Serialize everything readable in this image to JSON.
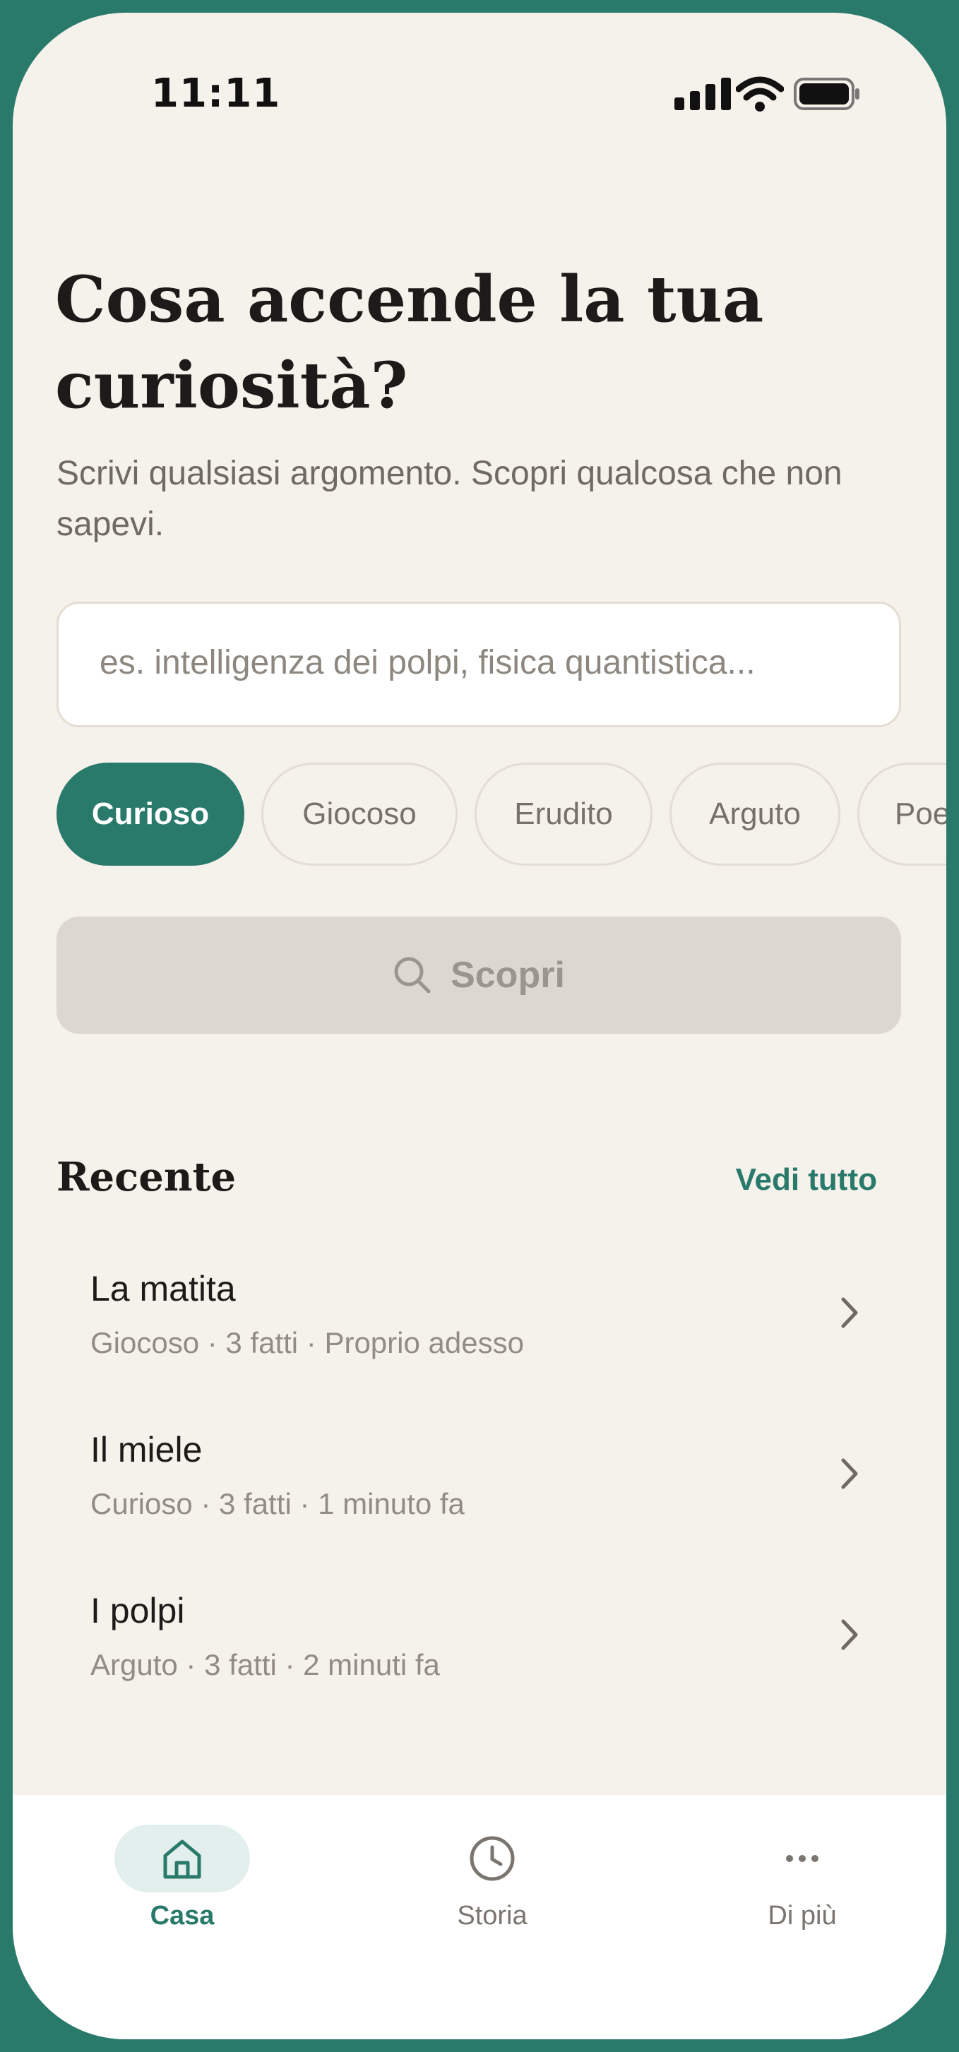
{
  "status_bar": {
    "time": "11:11"
  },
  "header": {
    "title": "Cosa accende la tua curiosità?",
    "subtitle": "Scrivi qualsiasi argomento. Scopri qualcosa che non sapevi."
  },
  "search": {
    "placeholder": "es. intelligenza dei polpi, fisica quantistica..."
  },
  "tones": [
    {
      "label": "Curioso",
      "selected": true
    },
    {
      "label": "Giocoso",
      "selected": false
    },
    {
      "label": "Erudito",
      "selected": false
    },
    {
      "label": "Arguto",
      "selected": false
    },
    {
      "label": "Poe",
      "selected": false
    }
  ],
  "discover_button": {
    "label": "Scopri",
    "enabled": false
  },
  "recent": {
    "title": "Recente",
    "see_all": "Vedi tutto",
    "items": [
      {
        "title": "La matita",
        "meta": "Giocoso · 3 fatti · Proprio adesso"
      },
      {
        "title": "Il miele",
        "meta": "Curioso · 3 fatti · 1 minuto fa"
      },
      {
        "title": "I polpi",
        "meta": "Arguto · 3 fatti · 2 minuti fa"
      }
    ]
  },
  "tab_bar": {
    "tabs": [
      {
        "label": "Casa",
        "icon": "home-icon",
        "active": true
      },
      {
        "label": "Storia",
        "icon": "clock-icon",
        "active": false
      },
      {
        "label": "Di più",
        "icon": "more-icon",
        "active": false
      }
    ]
  },
  "colors": {
    "accent": "#2a7a6c",
    "background": "#f5f1eb",
    "disabled_button": "#dcd8d1"
  }
}
